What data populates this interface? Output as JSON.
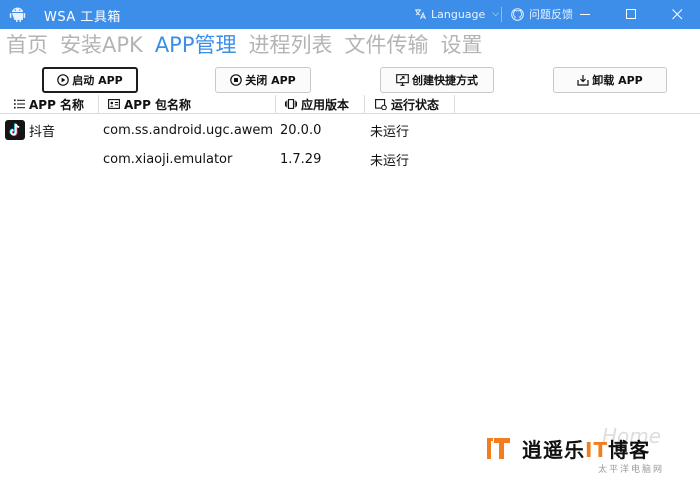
{
  "window": {
    "title": "WSA 工具箱",
    "language_label": "Language",
    "feedback_label": "问题反馈",
    "accent_color": "#3d8ee8"
  },
  "nav": {
    "tabs": [
      {
        "label": "首页",
        "active": false
      },
      {
        "label": "安装APK",
        "active": false
      },
      {
        "label": "APP管理",
        "active": true
      },
      {
        "label": "进程列表",
        "active": false
      },
      {
        "label": "文件传输",
        "active": false
      },
      {
        "label": "设置",
        "active": false
      }
    ]
  },
  "actions": {
    "start": {
      "label": "启动 APP",
      "icon": "play-circle-icon"
    },
    "stop": {
      "label": "关闭 APP",
      "icon": "stop-circle-icon"
    },
    "shortcut": {
      "label": "创建快捷方式",
      "icon": "monitor-shortcut-icon"
    },
    "uninstall": {
      "label": "卸载 APP",
      "icon": "uninstall-icon"
    }
  },
  "table": {
    "columns": [
      {
        "label": "APP 名称",
        "icon": "list-icon"
      },
      {
        "label": "APP 包名称",
        "icon": "id-card-icon"
      },
      {
        "label": "应用版本",
        "icon": "version-icon"
      },
      {
        "label": "运行状态",
        "icon": "status-icon"
      }
    ],
    "rows": [
      {
        "name": "抖音",
        "package": "com.ss.android.ugc.aweme",
        "version": "20.0.0",
        "status": "未运行",
        "icon": "tiktok-icon"
      },
      {
        "name": "",
        "package": "com.xiaoji.emulator",
        "version": "1.7.29",
        "status": "未运行",
        "icon": ""
      }
    ]
  },
  "watermark": {
    "text_pre": "逍遥乐",
    "text_hl": "IT",
    "text_post": "博客",
    "tagline": "太平洋电脑网",
    "faint": "Home"
  }
}
